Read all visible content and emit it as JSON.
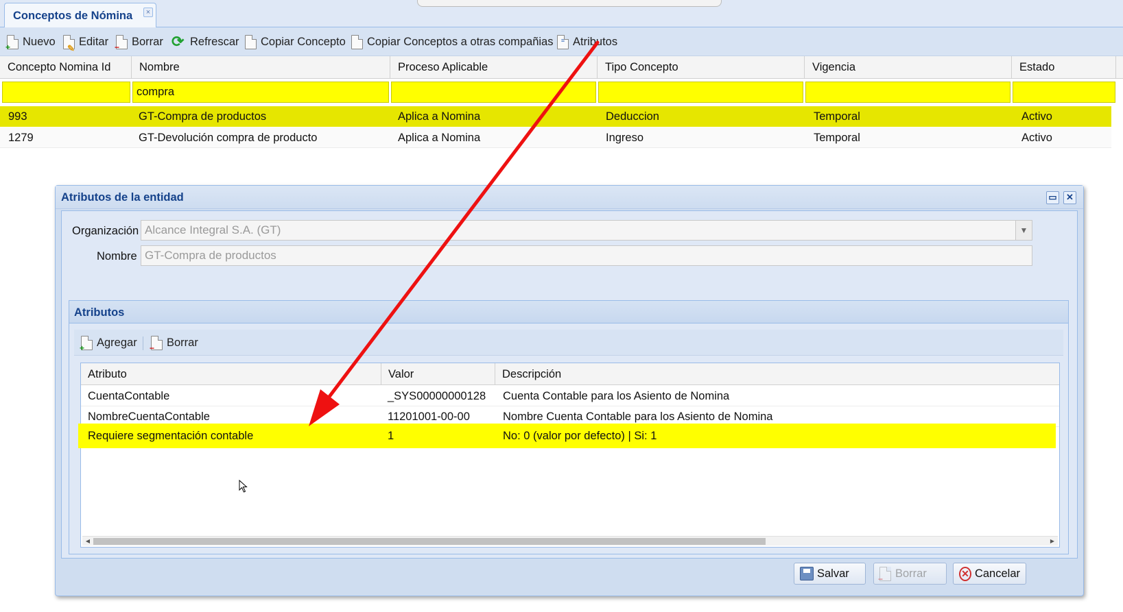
{
  "tab": {
    "title": "Conceptos de Nómina",
    "close": "×"
  },
  "toolbar": {
    "nuevo": "Nuevo",
    "editar": "Editar",
    "borrar": "Borrar",
    "refrescar": "Refrescar",
    "copiar_concepto": "Copiar Concepto",
    "copiar_otras": "Copiar Conceptos a otras compañias",
    "atributos": "Atributos"
  },
  "grid": {
    "columns": [
      "Concepto Nomina Id",
      "Nombre",
      "Proceso Aplicable",
      "Tipo Concepto",
      "Vigencia",
      "Estado"
    ],
    "filter": {
      "nombre": "compra"
    },
    "rows": [
      {
        "id": "993",
        "nombre": "GT-Compra de productos",
        "proceso": "Aplica a Nomina",
        "tipo": "Deduccion",
        "vigencia": "Temporal",
        "estado": "Activo"
      },
      {
        "id": "1279",
        "nombre": "GT-Devolución compra de producto",
        "proceso": "Aplica a Nomina",
        "tipo": "Ingreso",
        "vigencia": "Temporal",
        "estado": "Activo"
      }
    ]
  },
  "dialog": {
    "title": "Atributos de la entidad",
    "organizacion_label": "Organización",
    "organizacion_value": "Alcance Integral S.A. (GT)",
    "nombre_label": "Nombre",
    "nombre_value": "GT-Compra de productos",
    "fieldset_title": "Atributos",
    "agregar": "Agregar",
    "borrar": "Borrar",
    "columns": [
      "Atributo",
      "Valor",
      "Descripción"
    ],
    "rows": [
      {
        "atributo": "CuentaContable",
        "valor": "_SYS00000000128",
        "descripcion": "Cuenta Contable para los Asiento de Nomina"
      },
      {
        "atributo": "NombreCuentaContable",
        "valor": "11201001-00-00",
        "descripcion": "Nombre Cuenta Contable para los Asiento de Nomina"
      },
      {
        "atributo": "Requiere segmentación contable",
        "valor": "1",
        "descripcion": "No: 0 (valor por defecto) | Si: 1"
      }
    ],
    "buttons": {
      "salvar": "Salvar",
      "borrar": "Borrar",
      "cancelar": "Cancelar"
    }
  },
  "colors": {
    "highlight": "#ffff00",
    "selected_row": "#e6e600",
    "arrow": "#ee1111",
    "header_text": "#15428b"
  }
}
